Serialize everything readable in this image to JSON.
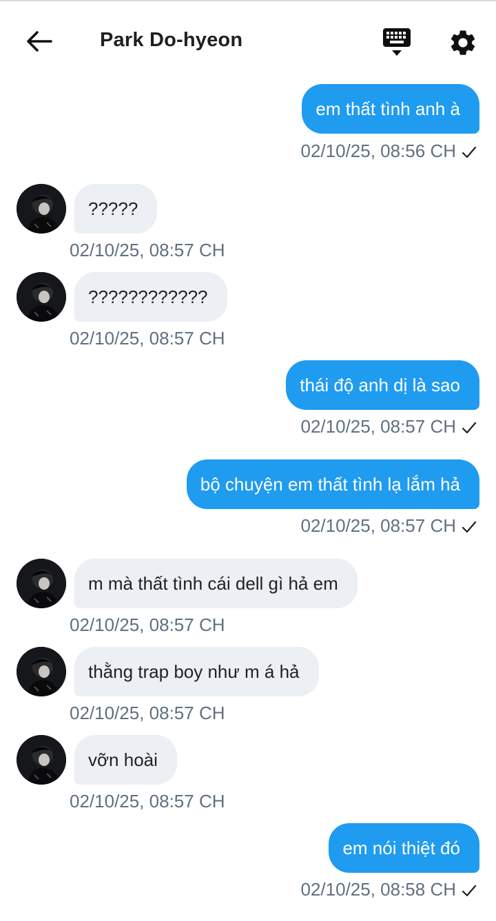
{
  "header": {
    "title": "Park Do-hyeon"
  },
  "messages": [
    {
      "side": "out",
      "text": "em thất tình anh à",
      "time": "02/10/25, 08:56 CH"
    },
    {
      "side": "in",
      "text": "?????",
      "time": "02/10/25, 08:57 CH"
    },
    {
      "side": "in",
      "text": "????????????",
      "time": "02/10/25, 08:57 CH"
    },
    {
      "side": "out",
      "text": "thái độ anh dị là sao",
      "time": "02/10/25, 08:57 CH"
    },
    {
      "side": "out",
      "text": "bộ chuyện em thất tình lạ lắm hả",
      "time": "02/10/25, 08:57 CH"
    },
    {
      "side": "in",
      "text": "m mà thất tình cái dell gì hả em",
      "time": "02/10/25, 08:57 CH"
    },
    {
      "side": "in",
      "text": "thằng trap boy như m á hả",
      "time": "02/10/25, 08:57 CH"
    },
    {
      "side": "in",
      "text": "vỡn hoài",
      "time": "02/10/25, 08:57 CH"
    },
    {
      "side": "out",
      "text": "em nói thiệt đó",
      "time": "02/10/25, 08:58 CH"
    }
  ],
  "icons": {
    "back": "arrow-left-icon",
    "keyboard": "keyboard-icon",
    "settings": "gear-icon",
    "read_receipt": "checkmark-icon"
  },
  "colors": {
    "outgoing_bubble": "#1f9bf0",
    "incoming_bubble": "#eceff3",
    "timestamp": "#606f82"
  }
}
